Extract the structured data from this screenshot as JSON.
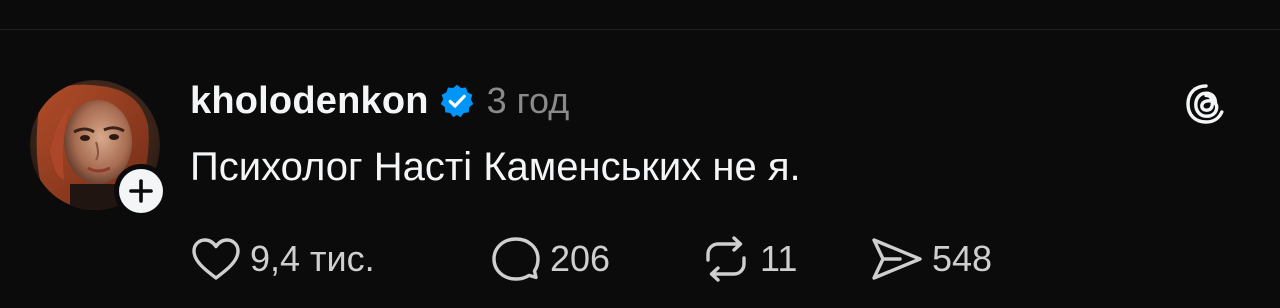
{
  "post": {
    "author": {
      "username": "kholodenkon",
      "verified": true,
      "avatar_icon": "profile-photo-avatar",
      "follow_icon": "plus-icon"
    },
    "timestamp": "3 год",
    "text": "Психолог Насті Каменських не я.",
    "app_icon": "threads-logo-icon"
  },
  "actions": {
    "like": {
      "icon": "heart-icon",
      "count": "9,4 тис."
    },
    "reply": {
      "icon": "comment-icon",
      "count": "206"
    },
    "repost": {
      "icon": "repost-icon",
      "count": "11"
    },
    "share": {
      "icon": "send-icon",
      "count": "548"
    }
  },
  "colors": {
    "background": "#0b0b0b",
    "text": "#f3f5f7",
    "muted": "#8a8a8a",
    "verified_blue": "#0095f6"
  }
}
